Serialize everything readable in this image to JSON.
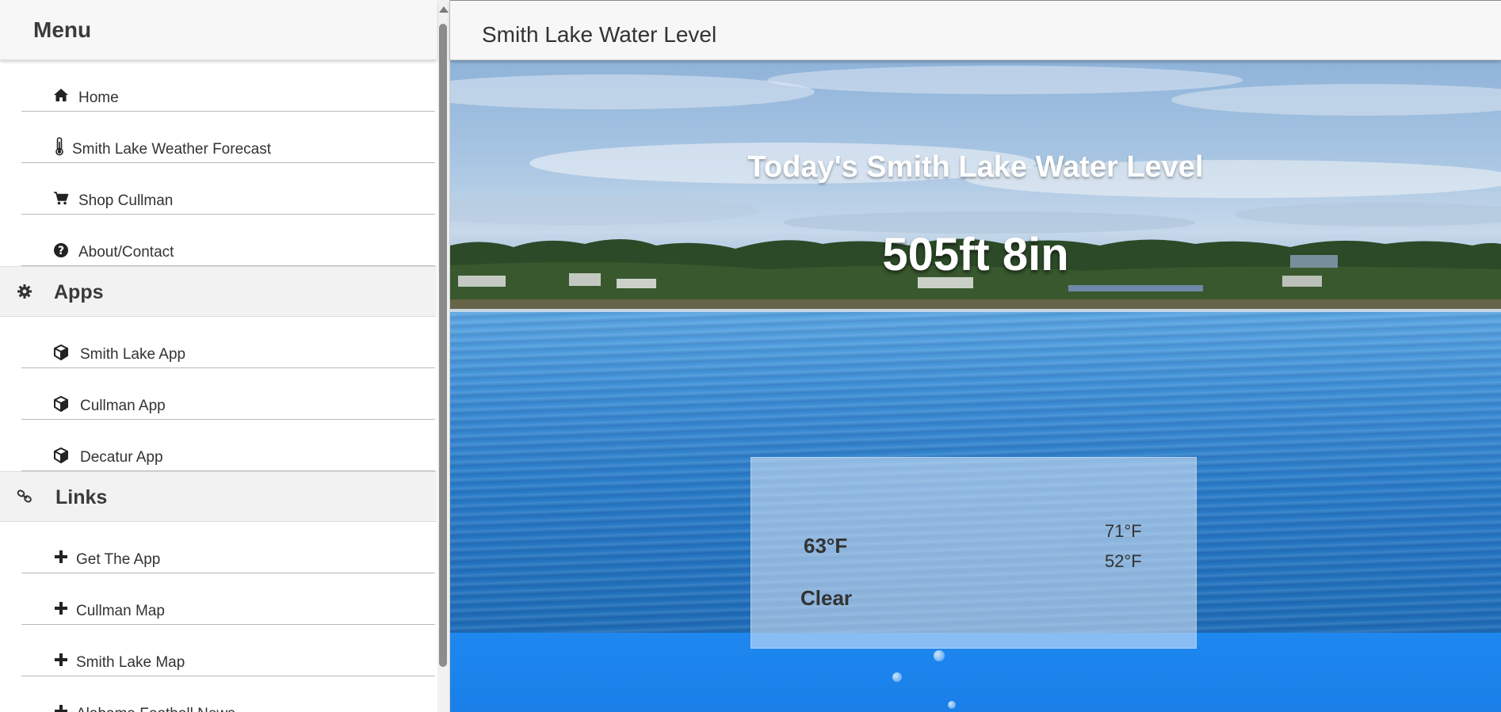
{
  "sidebar": {
    "menu_title": "Menu",
    "items_top": [
      {
        "label": "Home",
        "icon": "home-icon"
      },
      {
        "label": "Smith Lake Weather Forecast",
        "icon": "thermometer-icon"
      },
      {
        "label": "Shop Cullman",
        "icon": "cart-icon"
      },
      {
        "label": "About/Contact",
        "icon": "question-circle-icon"
      }
    ],
    "apps": {
      "label": "Apps",
      "icon": "gear-icon",
      "items": [
        {
          "label": "Smith Lake App",
          "icon": "cube-icon"
        },
        {
          "label": "Cullman App",
          "icon": "cube-icon"
        },
        {
          "label": "Decatur App",
          "icon": "cube-icon"
        }
      ]
    },
    "links": {
      "label": "Links",
      "icon": "link-icon",
      "items": [
        {
          "label": "Get The App",
          "icon": "plus-icon"
        },
        {
          "label": "Cullman Map",
          "icon": "plus-icon"
        },
        {
          "label": "Smith Lake Map",
          "icon": "plus-icon"
        },
        {
          "label": "Alabama Football News",
          "icon": "plus-icon"
        }
      ]
    }
  },
  "topbar": {
    "title": "Smith Lake Water Level"
  },
  "hero": {
    "heading": "Today's Smith Lake Water Level",
    "level": "505ft 8in"
  },
  "weather": {
    "temp": "63°F",
    "condition": "Clear",
    "high": "71°F",
    "low": "52°F"
  },
  "colors": {
    "accent_text": "#333333",
    "section_bg": "#f2f2f2",
    "water_deep": "#1e88f0"
  }
}
